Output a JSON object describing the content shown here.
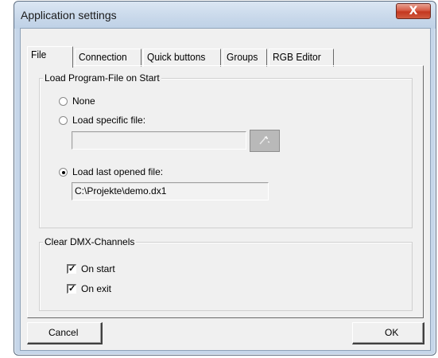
{
  "window": {
    "title": "Application settings",
    "close_label": "X"
  },
  "tabs": [
    "File",
    "Connection",
    "Quick buttons",
    "Groups",
    "RGB Editor"
  ],
  "load_program": {
    "label": "Load Program-File on Start",
    "options": [
      "None",
      "Load specific file:",
      "Load last opened file:"
    ],
    "selected": "Load last opened file:",
    "specific_file_value": "",
    "last_file_value": "C:\\Projekte\\demo.dx1"
  },
  "clear_dmx": {
    "label": "Clear DMX-Channels",
    "on_start_label": "On start",
    "on_start_checked": true,
    "on_exit_label": "On exit",
    "on_exit_checked": true
  },
  "buttons": {
    "cancel": "Cancel",
    "ok": "OK"
  },
  "icons": {
    "browse": "wand-icon"
  }
}
